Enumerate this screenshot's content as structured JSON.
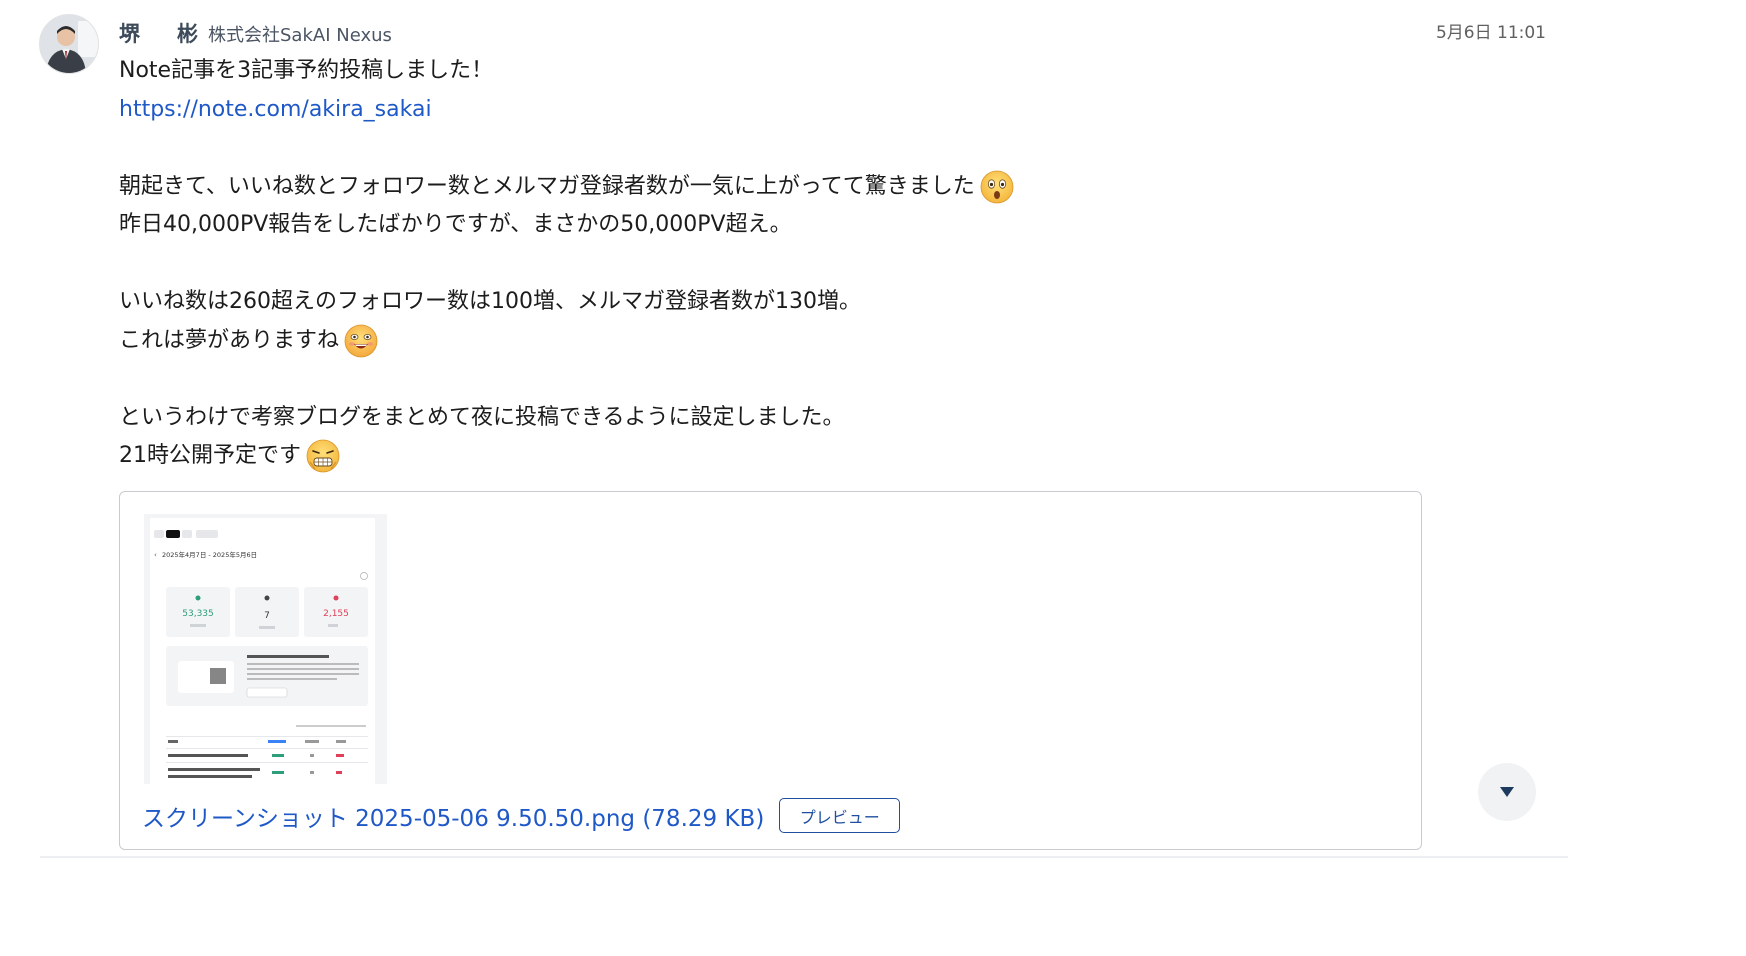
{
  "author": {
    "name": "堺　彬",
    "company": "株式会社SakAI Nexus"
  },
  "timestamp": "5月6日 11:01",
  "message": {
    "line1": "Note記事を3記事予約投稿しました！",
    "link": "https://note.com/akira_sakai",
    "line3": "朝起きて、いいね数とフォロワー数とメルマガ登録者数が一気に上がってて驚きました",
    "line4": "昨日40,000PV報告をしたばかりですが、まさかの50,000PV超え。",
    "line5": "いいね数は260超えのフォロワー数は100増、メルマガ登録者数が130増。",
    "line6": "これは夢がありますね",
    "line7": "というわけで考察ブログをまとめて夜に投稿できるように設定しました。",
    "line8": "21時公開予定です",
    "emojis": [
      "astonished-face",
      "grinning-face",
      "grimacing-face"
    ]
  },
  "attachment": {
    "file_name": "スクリーンショット 2025-05-06 9.50.50.png",
    "file_size": "(78.29 KB)",
    "preview_label": "プレビュー",
    "thumbnail": {
      "date_range": "2025年4月7日 - 2025年5月6日",
      "stat_views": "53,335",
      "stat_comments": "7",
      "stat_likes": "2,155"
    }
  },
  "colors": {
    "link": "#1f58c7",
    "button_border": "#1f4f9e",
    "author": "#3c4a5a"
  }
}
